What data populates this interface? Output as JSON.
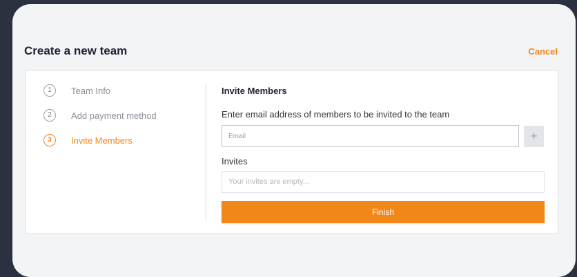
{
  "modal": {
    "title": "Create a new team",
    "cancel_label": "Cancel"
  },
  "steps": [
    {
      "number": "1",
      "label": "Team Info",
      "state": "inactive"
    },
    {
      "number": "2",
      "label": "Add payment method",
      "state": "inactive"
    },
    {
      "number": "3",
      "label": "Invite Members",
      "state": "active"
    }
  ],
  "invite": {
    "section_title": "Invite Members",
    "email_label": "Enter email address of members to be invited to the team",
    "email_placeholder": "Email",
    "email_value": "",
    "add_button_label": "+",
    "invites_label": "Invites",
    "invites_empty_text": "Your invites are empty...",
    "finish_label": "Finish"
  },
  "colors": {
    "accent": "#f28719",
    "background": "#2b3140",
    "modal": "#f3f4f6"
  },
  "icons": {
    "add": "plus-icon"
  }
}
